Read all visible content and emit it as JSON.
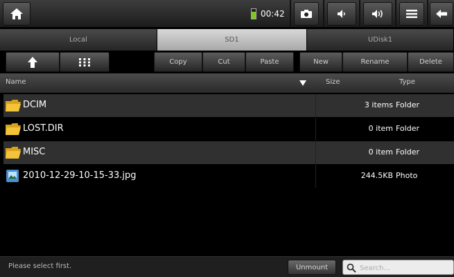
{
  "topbar": {
    "home_icon": "home-icon",
    "time": "00:42",
    "icons": [
      "camera-icon",
      "volume-down-icon",
      "volume-up-icon",
      "menu-icon",
      "back-icon"
    ]
  },
  "tabs": [
    {
      "label": "Local",
      "active": false
    },
    {
      "label": "SD1",
      "active": true
    },
    {
      "label": "UDisk1",
      "active": false
    }
  ],
  "toolbar": {
    "up_icon": "up-arrow-icon",
    "grid_icon": "grid-view-icon",
    "copy": "Copy",
    "cut": "Cut",
    "paste": "Paste",
    "new": "New",
    "rename": "Rename",
    "delete": "Delete"
  },
  "header": {
    "name": "Name",
    "sort_icon": "sort-down-icon",
    "size": "Size",
    "type": "Type"
  },
  "files": [
    {
      "name": "DCIM",
      "size": "3 items",
      "type": "Folder",
      "icon": "folder-icon"
    },
    {
      "name": "LOST.DIR",
      "size": "0 item",
      "type": "Folder",
      "icon": "folder-icon"
    },
    {
      "name": "MISC",
      "size": "0 item",
      "type": "Folder",
      "icon": "folder-icon"
    },
    {
      "name": "2010-12-29-10-15-33.jpg",
      "size": "244.5KB",
      "type": "Photo",
      "icon": "photo-icon"
    }
  ],
  "status": {
    "message": "Please select first.",
    "unmount": "Unmount",
    "search_placeholder": "Search...",
    "search_icon": "search-icon"
  }
}
